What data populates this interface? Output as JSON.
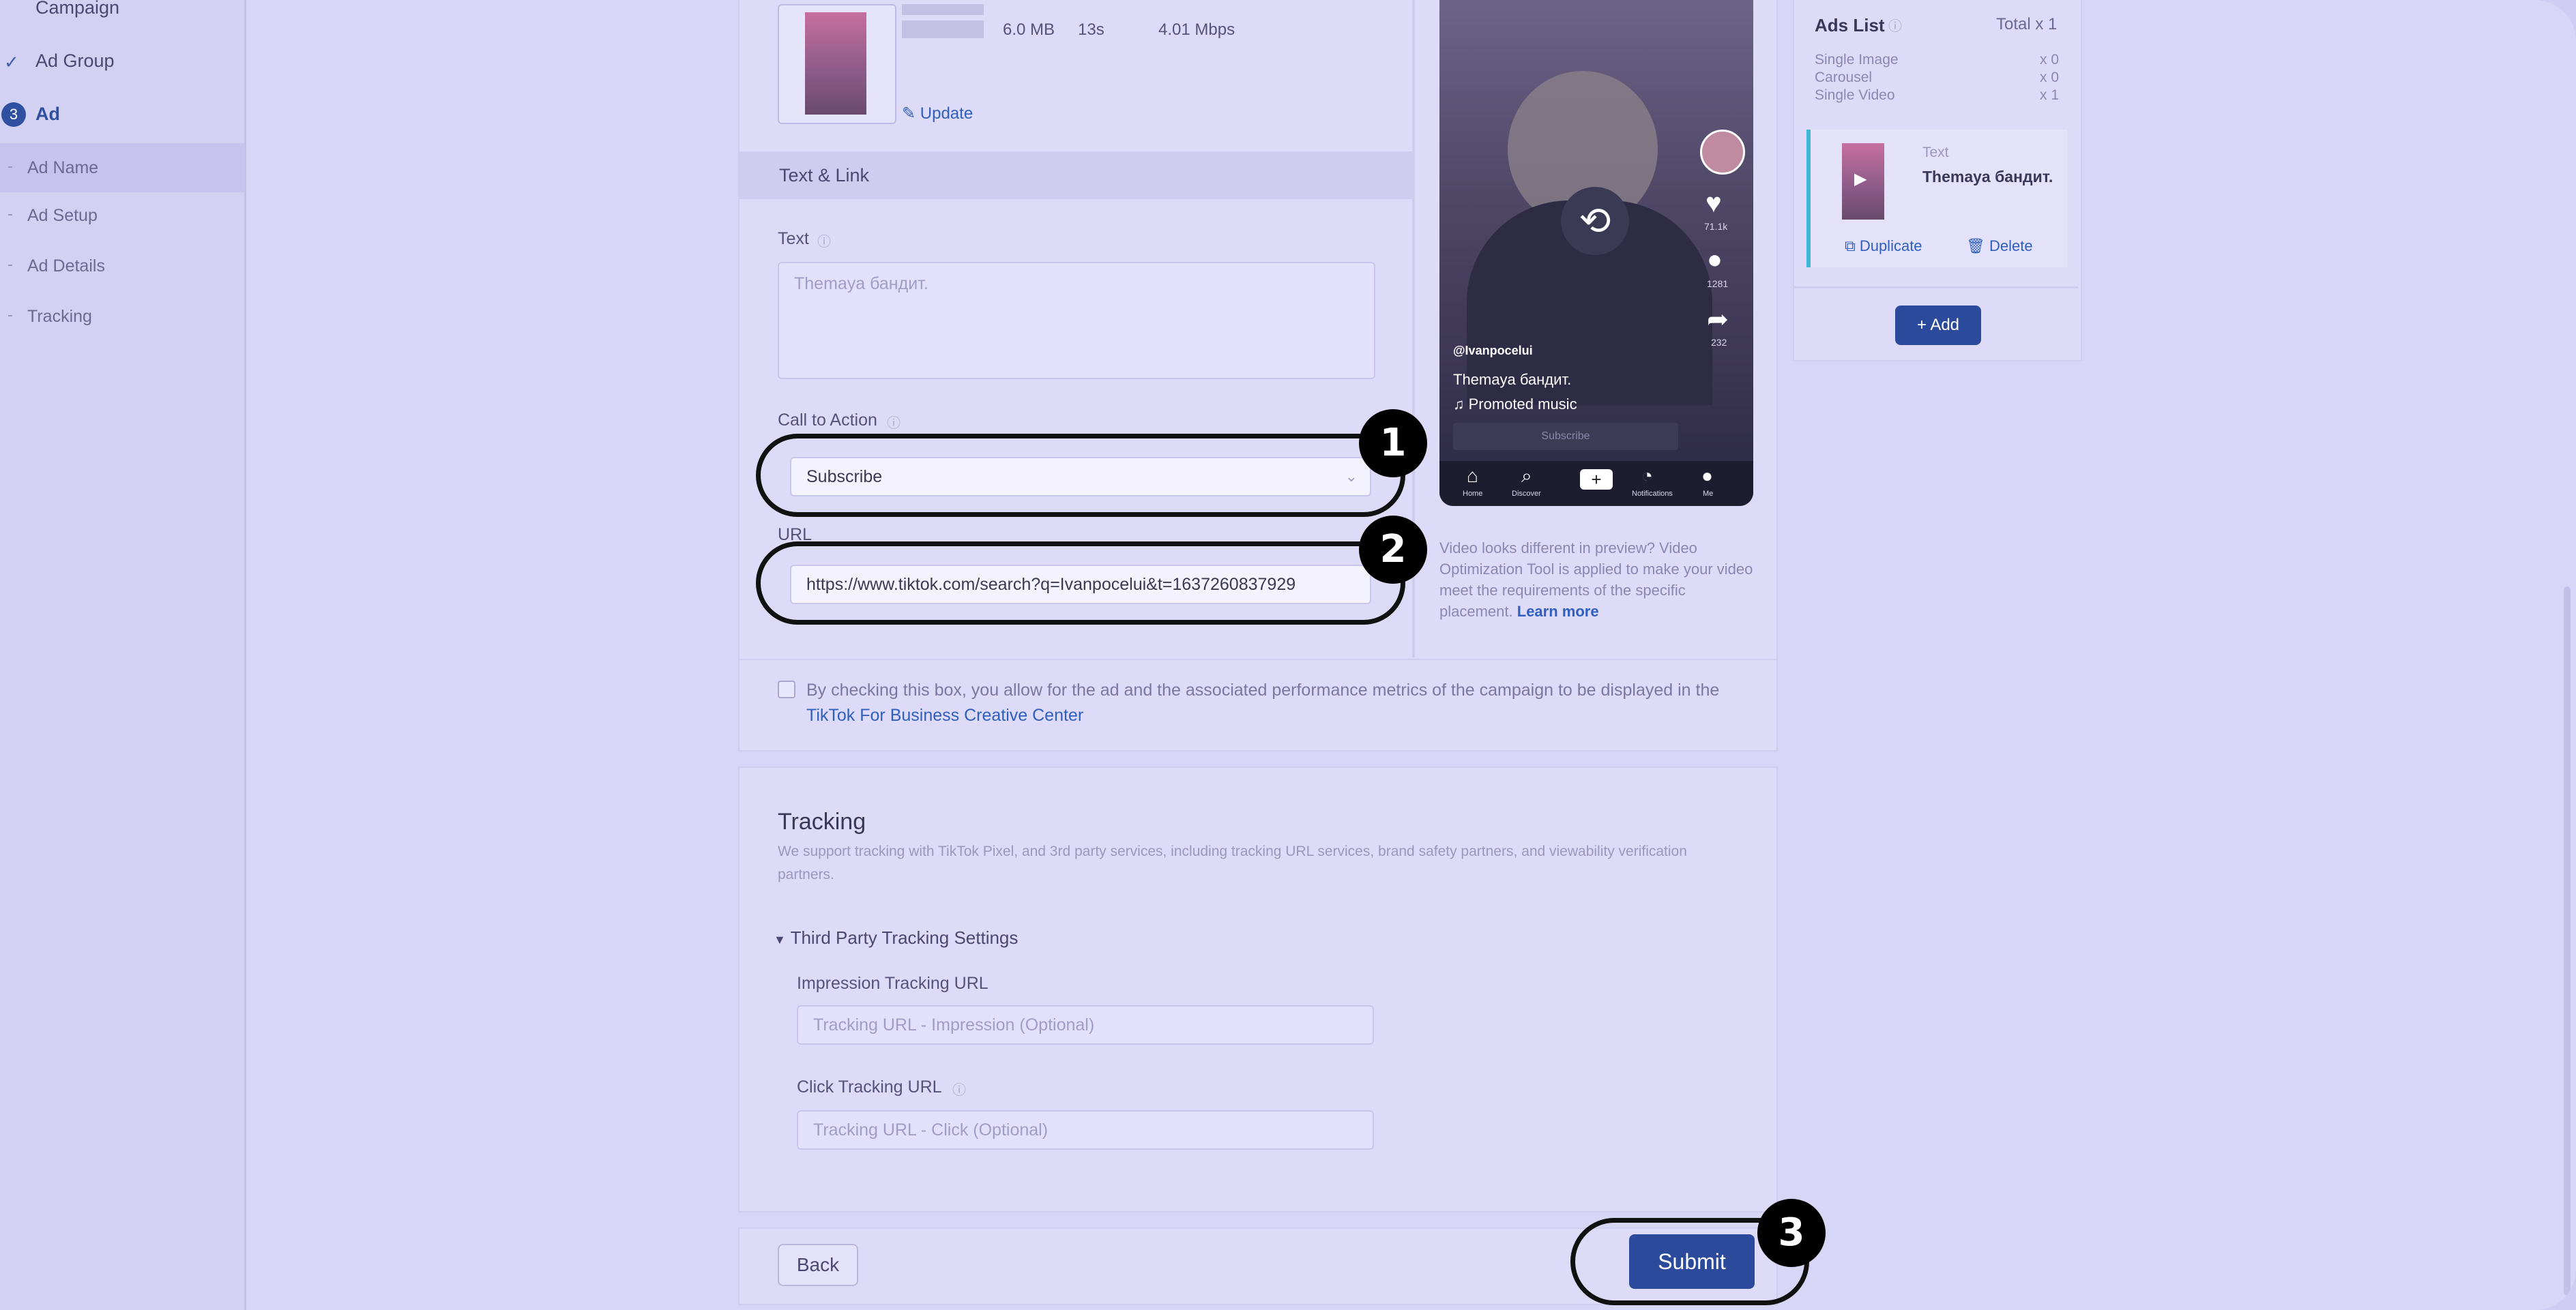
{
  "sidebar": {
    "items": [
      {
        "label": "Campaign"
      },
      {
        "label": "Ad Group"
      },
      {
        "label": "Ad",
        "step": "3"
      },
      {
        "label": "Ad Name"
      },
      {
        "label": "Ad Setup"
      },
      {
        "label": "Ad Details"
      },
      {
        "label": "Tracking"
      }
    ]
  },
  "media": {
    "meta_values": [
      "6.0 MB",
      "13s",
      "4.01 Mbps"
    ],
    "update_label": "Update"
  },
  "text_link": {
    "section_title": "Text & Link",
    "text_label": "Text",
    "text_placeholder": "Themaya бандит.",
    "cta_label": "Call to Action",
    "cta_value": "Subscribe",
    "url_label": "URL",
    "url_value": "https://www.tiktok.com/search?q=Ivanpocelui&t=1637260837929"
  },
  "preview": {
    "username": "@Ivanpocelui",
    "caption": "Themaya бандит.",
    "music": "Promoted music",
    "cta": "Subscribe",
    "likes": "71.1k",
    "comments": "1281",
    "shares": "232",
    "note": "Video looks different in preview? Video Optimization Tool is applied to make your video meet the requirements of the specific placement.",
    "learn_more": "Learn more",
    "nav": [
      "Home",
      "Discover",
      "",
      "Notifications",
      "Me"
    ]
  },
  "consent": {
    "text": "By checking this box, you allow for the ad and the associated performance metrics of the campaign to be displayed in the",
    "link": "TikTok For Business Creative Center"
  },
  "tracking": {
    "title": "Tracking",
    "description": "We support tracking with TikTok Pixel, and 3rd party services, including tracking URL services, brand safety partners, and viewability verification partners.",
    "third_party": "Third Party Tracking Settings",
    "impression_label": "Impression Tracking URL",
    "impression_placeholder": "Tracking URL - Impression (Optional)",
    "click_label": "Click Tracking URL",
    "click_placeholder": "Tracking URL - Click (Optional)"
  },
  "footer": {
    "back": "Back",
    "submit": "Submit"
  },
  "ads_list": {
    "title": "Ads List",
    "total": "Total x 1",
    "rows": [
      {
        "label": "Single Image",
        "count": "x 0"
      },
      {
        "label": "Carousel",
        "count": "x 0"
      },
      {
        "label": "Single Video",
        "count": "x 1"
      }
    ],
    "card_type": "Text",
    "card_text": "Themaya бандит.",
    "duplicate": "Duplicate",
    "delete": "Delete",
    "add": "+ Add"
  },
  "callouts": [
    "1",
    "2",
    "3"
  ]
}
